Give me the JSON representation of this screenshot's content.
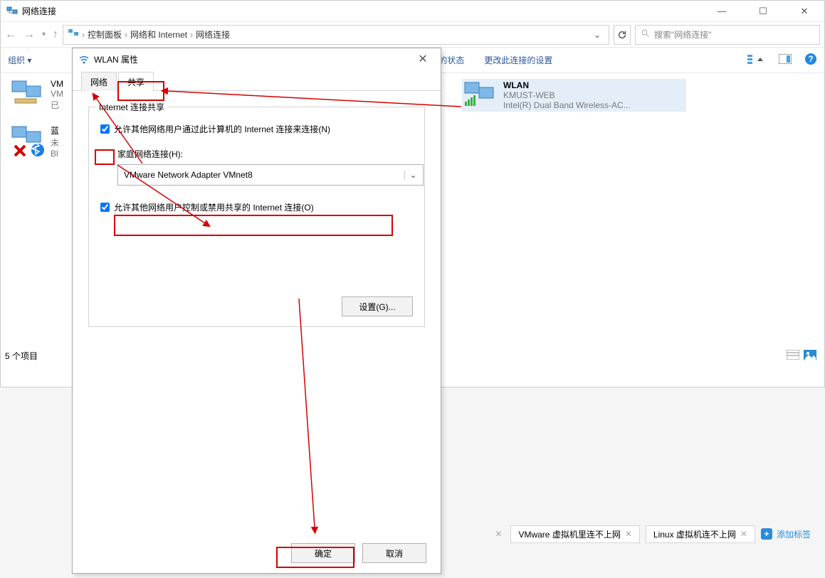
{
  "explorer": {
    "title": "网络连接",
    "breadcrumb": [
      "控制面板",
      "网络和 Internet",
      "网络连接"
    ],
    "search_placeholder": "搜索\"网络连接\"",
    "toolbar": {
      "organize": "组织 ▾",
      "status": "连接的状态",
      "change": "更改此连接的设置"
    },
    "connections": {
      "wlan": {
        "name": "WLAN",
        "ssid": "KMUST-WEB",
        "adapter": "Intel(R) Dual Band Wireless-AC..."
      },
      "left1": {
        "name": "VM",
        "l2": "VM",
        "l3": "已"
      },
      "left2": {
        "name": "蓝",
        "l2": "未",
        "l3": "Bl"
      }
    },
    "status_text": "5 个项目"
  },
  "dialog": {
    "title": "WLAN 属性",
    "tabs": {
      "network": "网络",
      "sharing": "共享"
    },
    "group_legend": "Internet 连接共享",
    "chk_allow_label": "允许其他网络用户通过此计算机的 Internet 连接来连接(N)",
    "home_label": "家庭网络连接(H):",
    "combo_value": "VMware Network Adapter VMnet8",
    "chk_control_label": "允许其他网络用户控制或禁用共享的 Internet 连接(O)",
    "settings_btn": "设置(G)...",
    "ok": "确定",
    "cancel": "取消"
  },
  "tags": {
    "t1": "VMware 虚拟机里连不上网",
    "t2": "Linux 虚拟机连不上网",
    "add": "添加标签"
  }
}
